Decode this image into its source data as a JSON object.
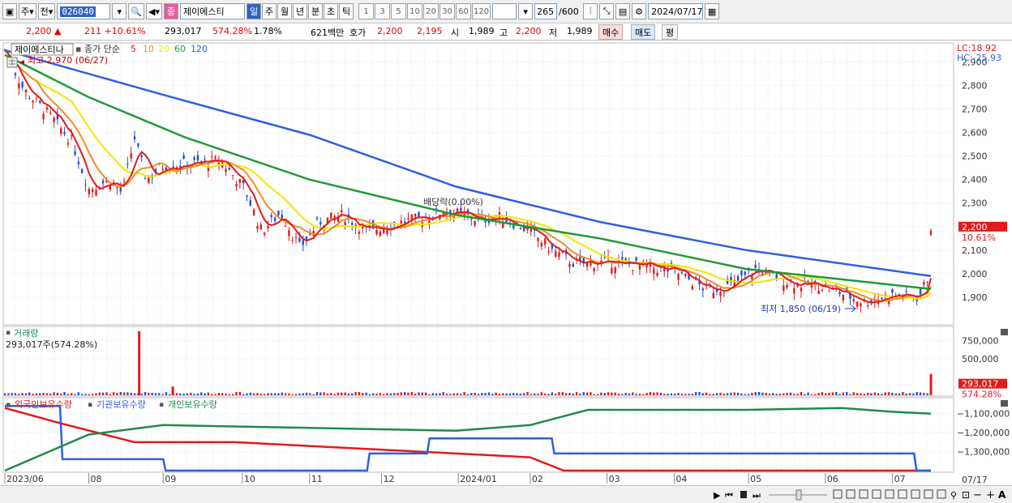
{
  "toolbar": {
    "left_items": [
      "주",
      "전"
    ],
    "stock_code": "026040",
    "stock_name": "제이에스티",
    "periods": [
      {
        "label": "일",
        "active": true
      },
      {
        "label": "주",
        "active": false
      },
      {
        "label": "월",
        "active": false
      },
      {
        "label": "년",
        "active": false
      },
      {
        "label": "분",
        "active": false
      },
      {
        "label": "초",
        "active": false
      },
      {
        "label": "틱",
        "active": false
      }
    ],
    "intervals": [
      "1",
      "3",
      "5",
      "10",
      "20",
      "30",
      "60",
      "120"
    ],
    "count": "265",
    "count_total": "/600",
    "date": "2024/07/17"
  },
  "quote": {
    "price": "2,200",
    "change_symbol": "▲",
    "change": "211",
    "change_pct": "+10.61%",
    "volume": "293,017",
    "volume_ratio": "574.28%",
    "turnover": "1.78%",
    "amount": "621백만",
    "ask_label": "호가",
    "ask": "2,200",
    "bid": "2,195",
    "open_label": "시",
    "open": "1,989",
    "high_label": "고",
    "high": "2,200",
    "low_label": "저",
    "low": "1,989",
    "buy_label": "매수",
    "sell_label": "매도",
    "flat_label": "평"
  },
  "price_panel": {
    "stock_name": "제이에스티나",
    "indicator_label": "종가 단순",
    "ma_periods": [
      "5",
      "10",
      "20",
      "60",
      "120"
    ],
    "ma_colors": [
      "#e31a1a",
      "#f28c28",
      "#f2e600",
      "#1f9a3a",
      "#2f5fe0"
    ],
    "high_marker": "최고 2,970 (06/27)",
    "low_marker": "최저 1,850 (06/19)",
    "dividend_marker": "배당락(0.00%)",
    "lc": "LC:18.92",
    "hc": "HC:-25.93",
    "last_price": "2,200",
    "last_pct": "10.61%"
  },
  "volume_panel": {
    "title": "거래량",
    "subtitle": "293,017주(574.28%)",
    "last_value": "293,017",
    "last_pct": "574.28%"
  },
  "holding_panel": {
    "series_labels": [
      "외국인보유수량",
      "기관보유수량",
      "개인보유수량"
    ],
    "series_colors": [
      "#e31a1a",
      "#2f5fe0",
      "#1f8a4c"
    ]
  },
  "x_labels": [
    "2023/06",
    "08",
    "09",
    "10",
    "11",
    "12",
    "2024/01",
    "02",
    "03",
    "04",
    "05",
    "06",
    "07"
  ],
  "x_label_end": "07/17",
  "chart_data": [
    {
      "type": "candlestick",
      "title": "제이에스티나",
      "y_ticks": [
        1900,
        2000,
        2100,
        2200,
        2300,
        2400,
        2500,
        2600,
        2700,
        2800,
        2900
      ],
      "ylim": [
        1800,
        2960
      ],
      "annotations": {
        "high": "최고 2,970 (06/27)",
        "low": "최저 1,850 (06/19)",
        "dividend": "배당락(0.00%)"
      },
      "close_path": [
        {
          "date": "2023/06/27",
          "value": 2950
        },
        {
          "date": "2023/07/05",
          "value": 2780
        },
        {
          "date": "2023/07/15",
          "value": 2680
        },
        {
          "date": "2023/07/25",
          "value": 2560
        },
        {
          "date": "2023/08/01",
          "value": 2360
        },
        {
          "date": "2023/08/10",
          "value": 2400
        },
        {
          "date": "2023/08/15",
          "value": 2340
        },
        {
          "date": "2023/08/20",
          "value": 2580
        },
        {
          "date": "2023/08/25",
          "value": 2400
        },
        {
          "date": "2023/09/01",
          "value": 2460
        },
        {
          "date": "2023/09/15",
          "value": 2470
        },
        {
          "date": "2023/09/25",
          "value": 2480
        },
        {
          "date": "2023/10/05",
          "value": 2360
        },
        {
          "date": "2023/10/12",
          "value": 2180
        },
        {
          "date": "2023/10/20",
          "value": 2260
        },
        {
          "date": "2023/10/28",
          "value": 2110
        },
        {
          "date": "2023/11/05",
          "value": 2220
        },
        {
          "date": "2023/11/15",
          "value": 2250
        },
        {
          "date": "2023/11/25",
          "value": 2180
        },
        {
          "date": "2023/12/05",
          "value": 2210
        },
        {
          "date": "2023/12/20",
          "value": 2240
        },
        {
          "date": "2023/12/28",
          "value": 2270
        },
        {
          "date": "2024/01/10",
          "value": 2230
        },
        {
          "date": "2024/01/20",
          "value": 2240
        },
        {
          "date": "2024/02/01",
          "value": 2180
        },
        {
          "date": "2024/02/10",
          "value": 2100
        },
        {
          "date": "2024/02/20",
          "value": 2040
        },
        {
          "date": "2024/03/05",
          "value": 2050
        },
        {
          "date": "2024/03/20",
          "value": 2030
        },
        {
          "date": "2024/04/01",
          "value": 2010
        },
        {
          "date": "2024/04/15",
          "value": 1930
        },
        {
          "date": "2024/04/25",
          "value": 1950
        },
        {
          "date": "2024/05/05",
          "value": 2020
        },
        {
          "date": "2024/05/20",
          "value": 1960
        },
        {
          "date": "2024/06/01",
          "value": 1950
        },
        {
          "date": "2024/06/19",
          "value": 1880
        },
        {
          "date": "2024/07/01",
          "value": 1910
        },
        {
          "date": "2024/07/12",
          "value": 1900
        },
        {
          "date": "2024/07/16",
          "value": 1989
        },
        {
          "date": "2024/07/17",
          "value": 2200
        }
      ],
      "series": [
        {
          "name": "120",
          "values": [
            {
              "date": "2023/06/27",
              "value": 2950
            },
            {
              "date": "2023/09/01",
              "value": 2760
            },
            {
              "date": "2023/11/01",
              "value": 2590
            },
            {
              "date": "2024/01/01",
              "value": 2370
            },
            {
              "date": "2024/03/01",
              "value": 2220
            },
            {
              "date": "2024/05/01",
              "value": 2100
            },
            {
              "date": "2024/07/17",
              "value": 1990
            }
          ]
        },
        {
          "name": "60",
          "values": [
            {
              "date": "2023/06/27",
              "value": 2930
            },
            {
              "date": "2023/08/01",
              "value": 2750
            },
            {
              "date": "2023/09/10",
              "value": 2580
            },
            {
              "date": "2023/11/01",
              "value": 2400
            },
            {
              "date": "2024/01/01",
              "value": 2250
            },
            {
              "date": "2024/03/01",
              "value": 2150
            },
            {
              "date": "2024/05/01",
              "value": 2020
            },
            {
              "date": "2024/07/17",
              "value": 1935
            }
          ]
        }
      ]
    },
    {
      "type": "bar",
      "title": "거래량",
      "y_ticks": [
        500000,
        750000
      ],
      "ylim": [
        0,
        900000
      ],
      "series": [
        {
          "name": "거래량",
          "spikes": [
            {
              "date": "2023/08/22",
              "value": 880000
            },
            {
              "date": "2023/09/05",
              "value": 120000
            },
            {
              "date": "2024/07/17",
              "value": 293017
            }
          ]
        }
      ]
    },
    {
      "type": "line",
      "title": "보유수량",
      "y_ticks": [
        -1100000,
        -1200000,
        -1300000
      ],
      "ylim": [
        -1400000,
        -1050000
      ],
      "series": [
        {
          "name": "외국인보유수량",
          "values": [
            {
              "date": "2023/06/27",
              "value": -1070000
            },
            {
              "date": "2023/07/20",
              "value": -1150000
            },
            {
              "date": "2023/08/20",
              "value": -1250000
            },
            {
              "date": "2023/10/01",
              "value": -1250000
            },
            {
              "date": "2024/02/01",
              "value": -1330000
            },
            {
              "date": "2024/02/15",
              "value": -1400000
            },
            {
              "date": "2024/07/17",
              "value": -1400000
            }
          ]
        },
        {
          "name": "기관보유수량",
          "values": [
            {
              "date": "2023/06/27",
              "value": -1060000
            },
            {
              "date": "2023/07/20",
              "value": -1060000
            },
            {
              "date": "2023/07/21",
              "value": -1340000
            },
            {
              "date": "2023/09/01",
              "value": -1340000
            },
            {
              "date": "2023/09/02",
              "value": -1400000
            },
            {
              "date": "2023/11/25",
              "value": -1400000
            },
            {
              "date": "2023/11/26",
              "value": -1310000
            },
            {
              "date": "2023/12/20",
              "value": -1310000
            },
            {
              "date": "2023/12/21",
              "value": -1230000
            },
            {
              "date": "2024/02/10",
              "value": -1230000
            },
            {
              "date": "2024/02/11",
              "value": -1310000
            },
            {
              "date": "2024/07/10",
              "value": -1310000
            },
            {
              "date": "2024/07/11",
              "value": -1400000
            },
            {
              "date": "2024/07/17",
              "value": -1400000
            }
          ]
        },
        {
          "name": "개인보유수량",
          "values": [
            {
              "date": "2023/06/27",
              "value": -1400000
            },
            {
              "date": "2023/08/01",
              "value": -1210000
            },
            {
              "date": "2023/09/01",
              "value": -1160000
            },
            {
              "date": "2024/01/01",
              "value": -1190000
            },
            {
              "date": "2024/02/01",
              "value": -1160000
            },
            {
              "date": "2024/02/25",
              "value": -1080000
            },
            {
              "date": "2024/05/01",
              "value": -1080000
            },
            {
              "date": "2024/06/10",
              "value": -1070000
            },
            {
              "date": "2024/07/01",
              "value": -1090000
            },
            {
              "date": "2024/07/17",
              "value": -1100000
            }
          ]
        }
      ]
    }
  ]
}
